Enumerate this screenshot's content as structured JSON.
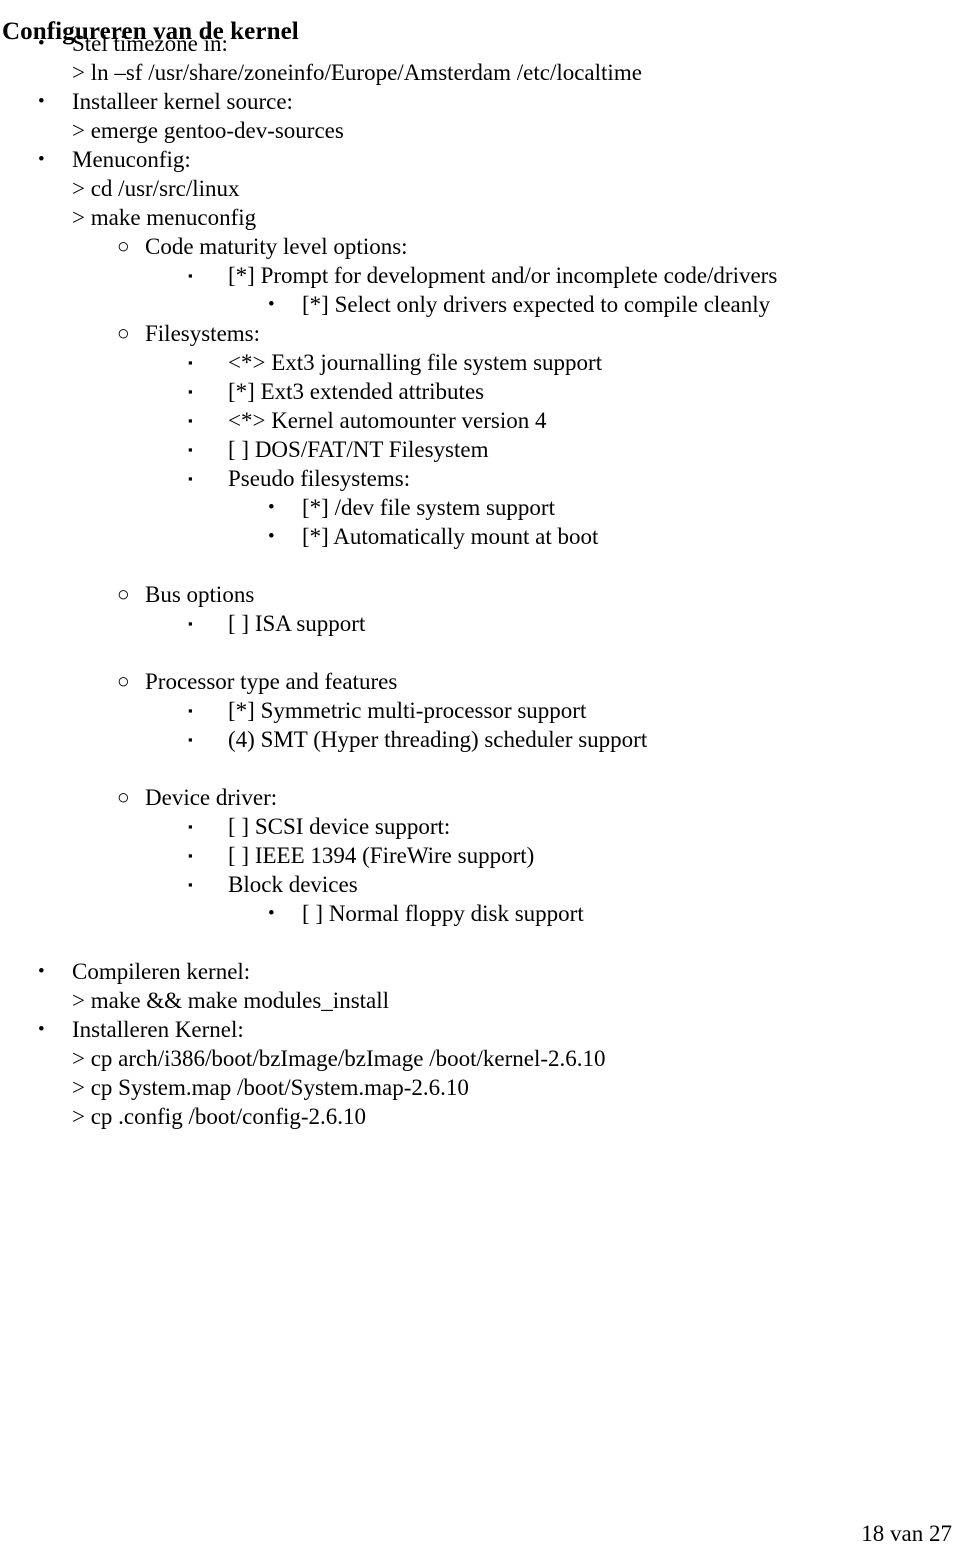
{
  "document": {
    "title": "Configureren van de kernel",
    "language": "nl",
    "footer": "18 van 27"
  },
  "bullet_glyphs": {
    "disc": "•",
    "circle": "○",
    "square": "▪"
  },
  "outline": [
    {
      "level": 1,
      "bullet": "disc",
      "text": "Stel timezone in:"
    },
    {
      "level": 1,
      "bullet": "none",
      "text": "> ln –sf /usr/share/zoneinfo/Europe/Amsterdam /etc/localtime"
    },
    {
      "level": 1,
      "bullet": "disc",
      "text": "Installeer kernel source:"
    },
    {
      "level": 1,
      "bullet": "none",
      "text": "> emerge gentoo-dev-sources"
    },
    {
      "level": 1,
      "bullet": "disc",
      "text": "Menuconfig:"
    },
    {
      "level": 1,
      "bullet": "none",
      "text": "> cd /usr/src/linux"
    },
    {
      "level": 1,
      "bullet": "none",
      "text": "> make menuconfig"
    },
    {
      "level": 2,
      "bullet": "circle",
      "text": "Code maturity level options:"
    },
    {
      "level": 3,
      "bullet": "square",
      "text": "[*] Prompt for development and/or incomplete code/drivers"
    },
    {
      "level": 4,
      "bullet": "disc",
      "text": "[*] Select only drivers expected to compile cleanly"
    },
    {
      "level": 2,
      "bullet": "circle",
      "text": "Filesystems:"
    },
    {
      "level": 3,
      "bullet": "square",
      "text": "<*> Ext3 journalling file system support"
    },
    {
      "level": 3,
      "bullet": "square",
      "text": "[*] Ext3 extended attributes"
    },
    {
      "level": 3,
      "bullet": "square",
      "text": "<*> Kernel automounter version 4"
    },
    {
      "level": 3,
      "bullet": "square",
      "text": "[ ] DOS/FAT/NT Filesystem"
    },
    {
      "level": 3,
      "bullet": "square",
      "text": "Pseudo filesystems:"
    },
    {
      "level": 4,
      "bullet": "disc",
      "text": "[*] /dev file system support"
    },
    {
      "level": 4,
      "bullet": "disc",
      "text": "[*] Automatically mount at boot"
    },
    {
      "level": 0,
      "bullet": "none",
      "text": ""
    },
    {
      "level": 2,
      "bullet": "circle",
      "text": "Bus options"
    },
    {
      "level": 3,
      "bullet": "square",
      "text": "[ ] ISA support"
    },
    {
      "level": 0,
      "bullet": "none",
      "text": ""
    },
    {
      "level": 2,
      "bullet": "circle",
      "text": "Processor type and features"
    },
    {
      "level": 3,
      "bullet": "square",
      "text": "[*] Symmetric multi-processor support"
    },
    {
      "level": 3,
      "bullet": "square",
      "text": "(4) SMT (Hyper threading) scheduler support"
    },
    {
      "level": 0,
      "bullet": "none",
      "text": ""
    },
    {
      "level": 2,
      "bullet": "circle",
      "text": "Device driver:"
    },
    {
      "level": 3,
      "bullet": "square",
      "text": "[ ] SCSI device support:"
    },
    {
      "level": 3,
      "bullet": "square",
      "text": "[ ] IEEE 1394 (FireWire support)"
    },
    {
      "level": 3,
      "bullet": "square",
      "text": "Block devices"
    },
    {
      "level": 4,
      "bullet": "disc",
      "text": "[ ] Normal floppy disk support"
    },
    {
      "level": 0,
      "bullet": "none",
      "text": ""
    },
    {
      "level": 1,
      "bullet": "disc",
      "text": "Compileren kernel:"
    },
    {
      "level": 1,
      "bullet": "none",
      "text": "> make && make modules_install"
    },
    {
      "level": 1,
      "bullet": "disc",
      "text": "Installeren Kernel:"
    },
    {
      "level": 1,
      "bullet": "none",
      "text": "> cp arch/i386/boot/bzImage/bzImage /boot/kernel-2.6.10"
    },
    {
      "level": 1,
      "bullet": "none",
      "text": "> cp System.map /boot/System.map-2.6.10"
    },
    {
      "level": 1,
      "bullet": "none",
      "text": "> cp .config /boot/config-2.6.10"
    }
  ]
}
